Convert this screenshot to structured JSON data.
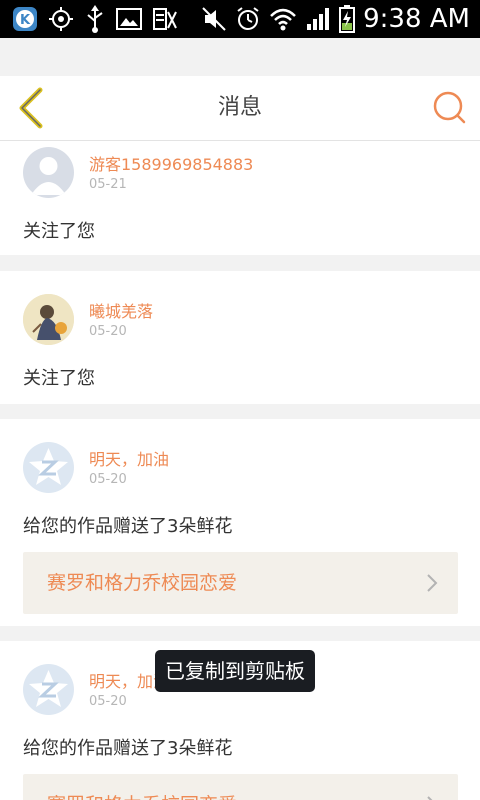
{
  "status_bar": {
    "time": "9:38 AM",
    "icons": [
      "k-app-icon",
      "gps-icon",
      "usb-icon",
      "gallery-icon",
      "input-icon",
      "mute-icon",
      "alarm-icon",
      "wifi-icon",
      "signal-icon",
      "battery-charging-icon"
    ]
  },
  "header": {
    "title": "消息",
    "back_icon": "chevron-left-icon",
    "search_icon": "search-icon",
    "accent": "#ee8a54"
  },
  "messages": [
    {
      "user": "游客1589969854883",
      "date": "05-21",
      "text": "关注了您",
      "avatar": "default-avatar"
    },
    {
      "user": "曦城羌落",
      "date": "05-20",
      "text": "关注了您",
      "avatar": "photo-avatar"
    },
    {
      "user": "明天，加油",
      "date": "05-20",
      "text": "给您的作品赠送了3朵鲜花",
      "avatar": "qzone-avatar",
      "work": "赛罗和格力乔校园恋爱"
    },
    {
      "user": "明天，加油",
      "date": "05-20",
      "text": "给您的作品赠送了3朵鲜花",
      "avatar": "qzone-avatar",
      "work": "赛罗和格力乔校园恋爱"
    }
  ],
  "toast": "已复制到剪贴板"
}
